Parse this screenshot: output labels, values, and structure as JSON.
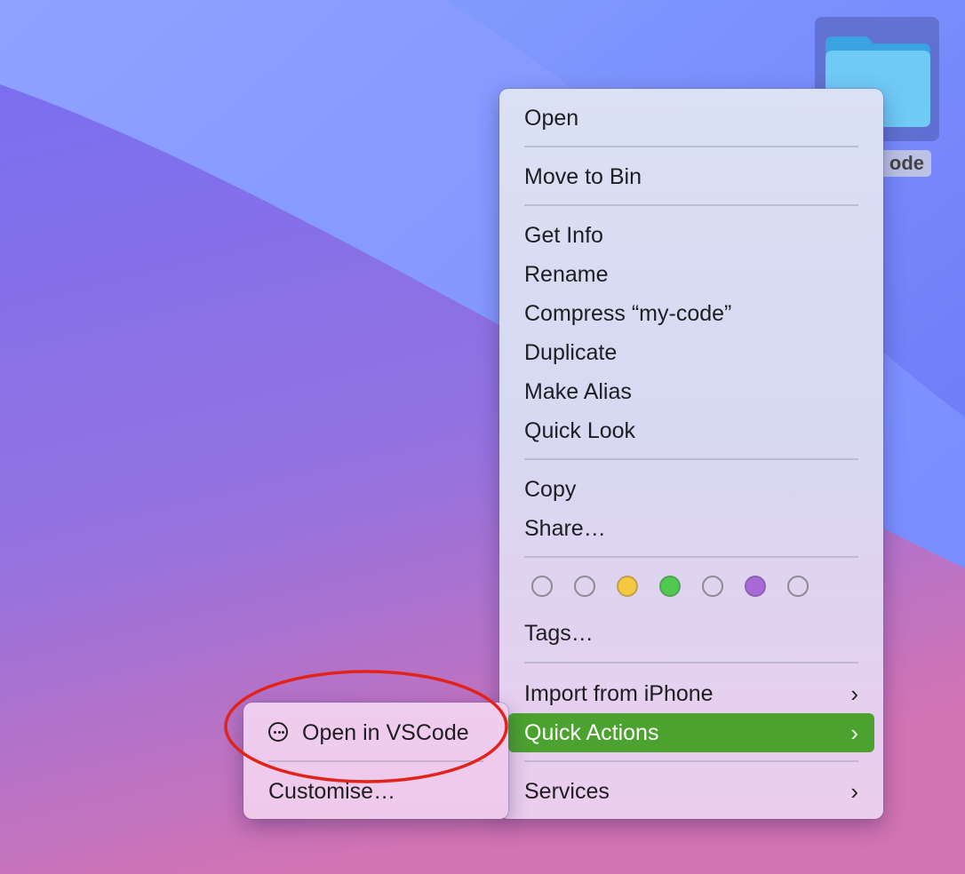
{
  "desktop": {
    "folder_label": "ode",
    "folder_icon": "folder-icon"
  },
  "context_menu": {
    "open": "Open",
    "move_to_bin": "Move to Bin",
    "get_info": "Get Info",
    "rename": "Rename",
    "compress": "Compress “my-code”",
    "duplicate": "Duplicate",
    "make_alias": "Make Alias",
    "quick_look": "Quick Look",
    "copy": "Copy",
    "share": "Share…",
    "tag_colors": [
      "none",
      "none",
      "#f5c842",
      "#4fc94f",
      "none",
      "#a868d8",
      "none"
    ],
    "tags": "Tags…",
    "import_from_iphone": "Import from iPhone",
    "quick_actions": "Quick Actions",
    "services": "Services",
    "chevron": "›",
    "active_color": "#4ba22f"
  },
  "submenu": {
    "open_in_vscode": "Open in VSCode",
    "customise": "Customise…",
    "action_icon": "ellipsis-circle-icon"
  },
  "annotation": {
    "ring_color": "#e0241b"
  }
}
